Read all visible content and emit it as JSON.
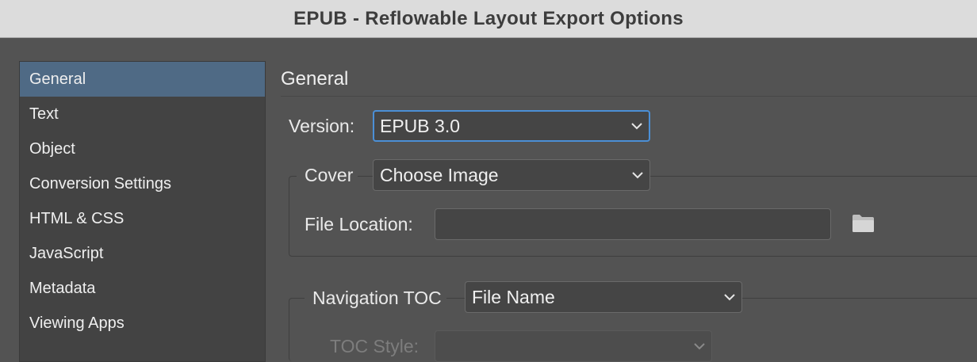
{
  "window": {
    "title": "EPUB - Reflowable Layout Export Options"
  },
  "sidebar": {
    "items": [
      {
        "label": "General",
        "selected": true
      },
      {
        "label": "Text"
      },
      {
        "label": "Object"
      },
      {
        "label": "Conversion Settings"
      },
      {
        "label": "HTML & CSS"
      },
      {
        "label": "JavaScript"
      },
      {
        "label": "Metadata"
      },
      {
        "label": "Viewing Apps"
      }
    ]
  },
  "main": {
    "section_title": "General",
    "version": {
      "label": "Version:",
      "value": "EPUB 3.0"
    },
    "cover": {
      "label": "Cover",
      "value": "Choose Image",
      "file_location_label": "File Location:",
      "file_location_value": ""
    },
    "navigation_toc": {
      "label": "Navigation TOC",
      "value": "File Name",
      "toc_style_label": "TOC Style:",
      "toc_style_value": ""
    }
  },
  "icons": {
    "folder": "folder-icon",
    "chevron": "chevron-down-icon"
  },
  "colors": {
    "accent_focus": "#4b8fd6",
    "selected_item": "#4f6a85",
    "panel_bg": "#535353",
    "titlebar_bg": "#dcdcdc"
  }
}
